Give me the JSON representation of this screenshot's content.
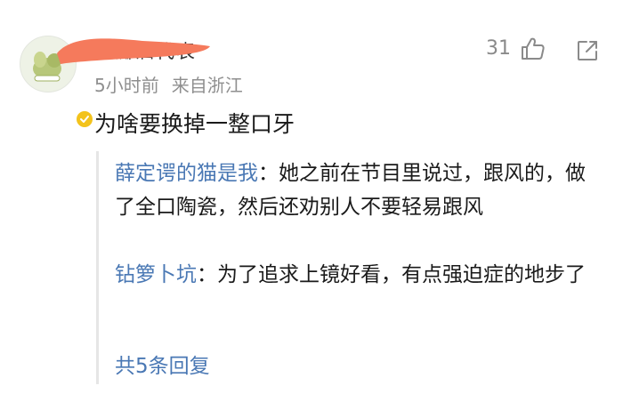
{
  "comment": {
    "username": "花瓣泗代表",
    "time": "5小时前",
    "location": "来自浙江",
    "like_count": "31",
    "text": "为啥要换掉一整口牙",
    "icons": {
      "like": "thumbs-up-icon",
      "share": "share-icon",
      "verified": "verified-badge-icon"
    },
    "colors": {
      "link": "#4a78b4",
      "redaction": "#f57a5c",
      "badge": "#f3c31c"
    }
  },
  "replies": [
    {
      "author": "薛定谔的猫是我",
      "separator": "：",
      "text": "她之前在节目里说过，跟风的，做了全口陶瓷，然后还劝别人不要轻易跟风"
    },
    {
      "author": "钻箩卜坑",
      "separator": "：",
      "text": "为了追求上镜好看，有点强迫症的地步了"
    }
  ],
  "more_replies_label": "共5条回复"
}
